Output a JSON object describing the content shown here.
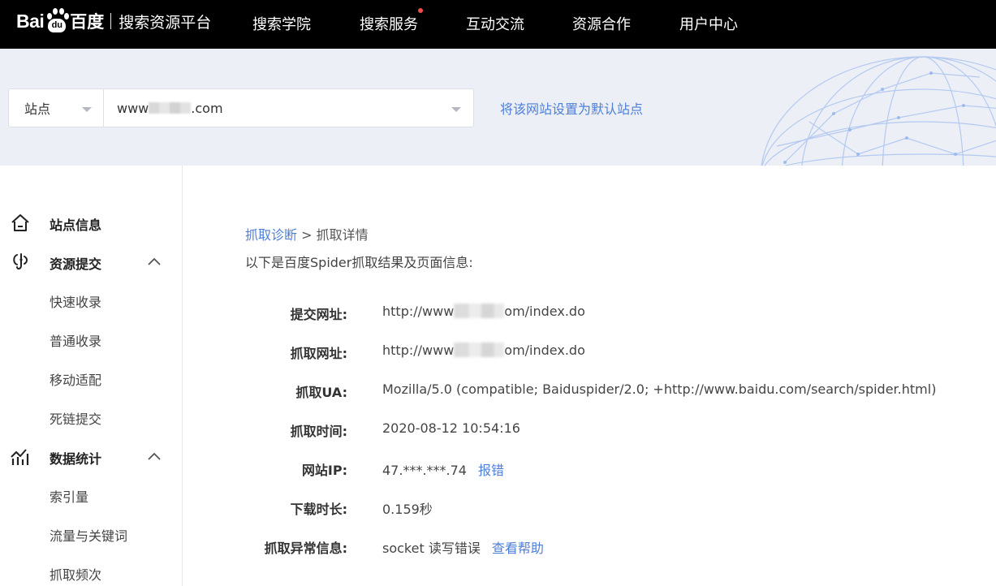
{
  "brand": {
    "logo_latin": "Bai",
    "logo_paw": "du",
    "logo_cn": "百度",
    "subtitle": "搜索资源平台"
  },
  "nav": {
    "items": [
      {
        "label": "搜索学院"
      },
      {
        "label": "搜索服务",
        "has_dot": true
      },
      {
        "label": "互动交流"
      },
      {
        "label": "资源合作"
      },
      {
        "label": "用户中心"
      }
    ],
    "dot_color": "#f24b4b"
  },
  "site_selector": {
    "type_label": "站点",
    "url_prefix": "www",
    "url_suffix": ".com",
    "set_default": "将该网站设置为默认站点"
  },
  "sidebar": {
    "groups": [
      {
        "label": "站点信息",
        "icon": "home-icon"
      },
      {
        "label": "资源提交",
        "icon": "submit-resource-icon",
        "expanded": true,
        "items": [
          "快速收录",
          "普通收录",
          "移动适配",
          "死链提交"
        ]
      },
      {
        "label": "数据统计",
        "icon": "data-statistics-icon",
        "expanded": true,
        "items": [
          "索引量",
          "流量与关键词",
          "抓取频次"
        ]
      }
    ]
  },
  "main": {
    "breadcrumb": {
      "parent": "抓取诊断",
      "separator": ">",
      "current": "抓取详情"
    },
    "intro": "以下是百度Spider抓取结果及页面信息:",
    "details": [
      {
        "key": "提交网址:",
        "prefix": "http://www",
        "suffix": "om/index.do"
      },
      {
        "key": "抓取网址:",
        "prefix": "http://www",
        "suffix": "om/index.do"
      },
      {
        "key": "抓取UA:",
        "value": "Mozilla/5.0 (compatible; Baiduspider/2.0; +http://www.baidu.com/search/spider.html)"
      },
      {
        "key": "抓取时间:",
        "value": "2020-08-12 10:54:16"
      },
      {
        "key": "网站IP:",
        "value": "47.***.***.74",
        "link": "报错"
      },
      {
        "key": "下载时长:",
        "value": "0.159秒"
      },
      {
        "key": "抓取异常信息:",
        "value": "socket 读写错误",
        "link": "查看帮助"
      }
    ]
  },
  "colors": {
    "topbar": "#000000",
    "band": "#edeff6",
    "link": "#4e7fd8"
  }
}
